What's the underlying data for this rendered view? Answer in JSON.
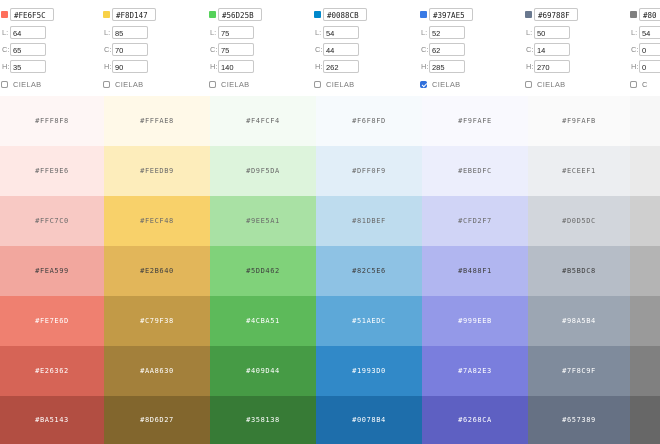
{
  "columns": [
    {
      "hex": "#FE6F5C",
      "color": "#FE6F5C",
      "L": "64",
      "C": "65",
      "H": "35",
      "cielab": false,
      "cielab_label": "CIELAB",
      "shades": [
        "#FFF8F8",
        "#FFE9E6",
        "#FFC7C0",
        "#FEA599",
        "#FE7E6D",
        "#E26362",
        "#BA5143"
      ]
    },
    {
      "hex": "#F8D147",
      "color": "#F8D147",
      "L": "85",
      "C": "70",
      "H": "90",
      "cielab": false,
      "cielab_label": "CIELAB",
      "shades": [
        "#FFFAE8",
        "#FEEDB9",
        "#FECF48",
        "#E2B640",
        "#C79F38",
        "#AA8630",
        "#8D6D27"
      ]
    },
    {
      "hex": "#56D25B",
      "color": "#56D25B",
      "L": "75",
      "C": "75",
      "H": "140",
      "cielab": false,
      "cielab_label": "CIELAB",
      "shades": [
        "#F4FCF4",
        "#D9F5DA",
        "#9EE5A1",
        "#5DD462",
        "#4CBA51",
        "#409D44",
        "#358138"
      ]
    },
    {
      "hex": "#0088CB",
      "color": "#0088CB",
      "L": "54",
      "C": "44",
      "H": "262",
      "cielab": false,
      "cielab_label": "CIELAB",
      "shades": [
        "#F6F8FD",
        "#DFF0F9",
        "#81DBEF",
        "#82C5E6",
        "#51AEDC",
        "#1993D0",
        "#0078B4"
      ]
    },
    {
      "hex": "#397AE5",
      "color": "#397AE5",
      "L": "52",
      "C": "62",
      "H": "285",
      "cielab": true,
      "cielab_label": "CIELAB",
      "shades": [
        "#F9FAFE",
        "#EBEDFC",
        "#CFD2F7",
        "#B488F1",
        "#999EEB",
        "#7A82E3",
        "#6268CA"
      ]
    },
    {
      "hex": "#69788F",
      "color": "#69788F",
      "L": "50",
      "C": "14",
      "H": "270",
      "cielab": false,
      "cielab_label": "CIELAB",
      "shades": [
        "#F9FAFB",
        "#ECEEF1",
        "#D0D5DC",
        "#B5BDC8",
        "#98A5B4",
        "#7F8C9F",
        "#657389"
      ]
    },
    {
      "hex": "#80",
      "color": "#808080",
      "L": "54",
      "C": "0",
      "H": "0",
      "cielab": false,
      "cielab_label": "C",
      "shades": [
        "",
        "",
        "",
        "",
        "",
        "",
        ""
      ]
    }
  ],
  "cell_colors": [
    [
      "#FEF6F5",
      "#FEE8E5",
      "#F8C9C4",
      "#F2A79E",
      "#EF8070",
      "#D66456",
      "#B24E42"
    ],
    [
      "#FFF9E8",
      "#FDEDBB",
      "#F8D16A",
      "#E2B65A",
      "#C29A47",
      "#A3803B",
      "#82662D"
    ],
    [
      "#F4FBF4",
      "#DDF4DC",
      "#A9E1A4",
      "#80D27A",
      "#5DBA5A",
      "#469B45",
      "#377B36"
    ],
    [
      "#F6FAFD",
      "#E1EEF8",
      "#BEDCEE",
      "#8EC2E4",
      "#5DA8D8",
      "#3189C8",
      "#1E6EAB"
    ],
    [
      "#F9F9FE",
      "#ECEEFC",
      "#D0D4F6",
      "#B1B6F0",
      "#9499E8",
      "#7A7EDD",
      "#5E60C2"
    ],
    [
      "#FAFAFA",
      "#ECEEF1",
      "#D2D6DC",
      "#B6BDC7",
      "#9CA6B3",
      "#7F8B9C",
      "#667184"
    ],
    [
      "#F7F7F7",
      "#EAEAEA",
      "#CFCFCF",
      "#B4B4B4",
      "#9A9A9A",
      "#808080",
      "#676767"
    ]
  ],
  "text_colors": [
    "#6a6a6a",
    "#6a6a6a",
    "#6a6a6a",
    "#3f3f3f",
    "#ffffff",
    "#ffffff",
    "#ffffff"
  ]
}
